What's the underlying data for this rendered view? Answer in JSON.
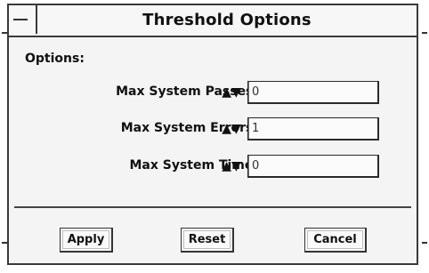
{
  "window": {
    "title": "Threshold Options"
  },
  "section": {
    "label": "Options:"
  },
  "fields": [
    {
      "label": "Max System Passes:",
      "value": "0"
    },
    {
      "label": "Max System Errors:",
      "value": "1"
    },
    {
      "label": "Max System Time:",
      "value": "0"
    }
  ],
  "spinner": {
    "up": "▲",
    "down": "▼"
  },
  "buttons": {
    "apply": "Apply",
    "reset": "Reset",
    "cancel": "Cancel"
  }
}
